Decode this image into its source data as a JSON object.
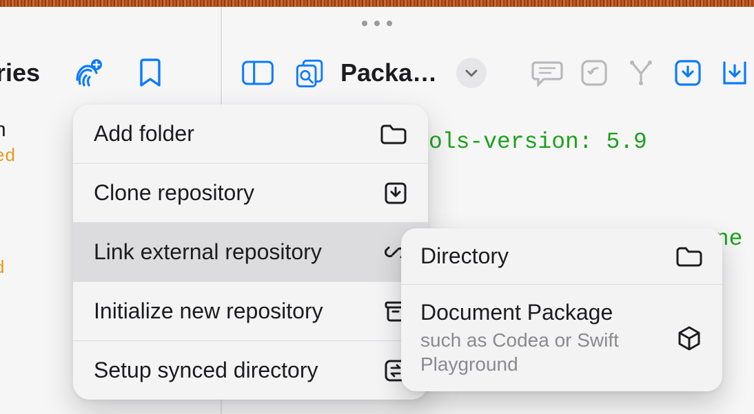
{
  "sidebar": {
    "tab_label": "tories",
    "items": [
      {
        "title_suffix": "n",
        "status_suffix": "ed"
      },
      {
        "status_suffix": "d"
      }
    ]
  },
  "editor": {
    "tab_title": "Packa…",
    "code_line_1": "ols-version: 5.9",
    "code_line_2": "e is automatically gene"
  },
  "icons": {
    "touchid": "touchid-add-icon",
    "bookmark": "bookmark-icon",
    "sidebar_toggle": "sidebar-left-icon",
    "find": "find-in-files-icon",
    "chevron": "chevron-down-icon",
    "comment": "comment-bubble-icon",
    "undo": "undo-icon",
    "funnel": "fork-icon",
    "download_square": "download-square-icon",
    "download_box": "download-open-icon",
    "folder": "folder-icon",
    "link": "link-icon",
    "archive": "archivebox-icon",
    "sync": "sync-swap-icon",
    "package": "package-cube-icon"
  },
  "menu": {
    "items": [
      {
        "label": "Add folder"
      },
      {
        "label": "Clone repository"
      },
      {
        "label": "Link external repository"
      },
      {
        "label": "Initialize new repository"
      },
      {
        "label": "Setup synced directory"
      }
    ],
    "active_index": 2
  },
  "submenu": {
    "items": [
      {
        "title": "Directory",
        "subtitle": ""
      },
      {
        "title": "Document Package",
        "subtitle": "such as Codea or Swift Playground"
      }
    ]
  }
}
